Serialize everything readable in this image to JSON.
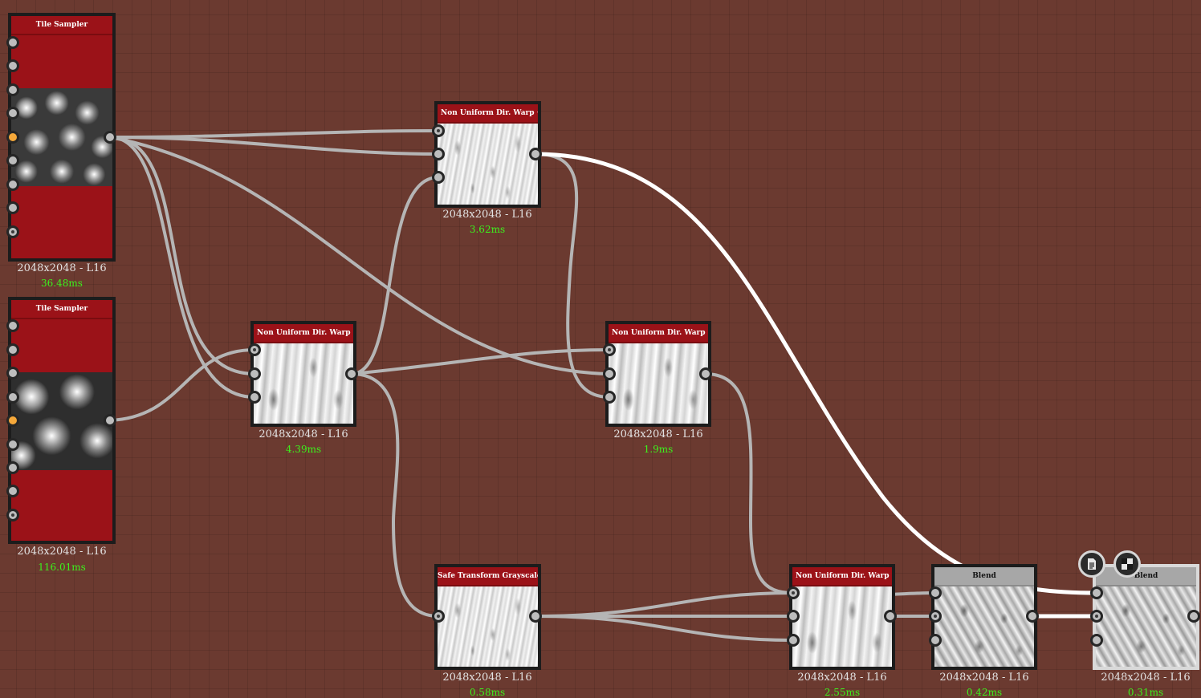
{
  "graph": {
    "nodes": [
      {
        "id": "tile1",
        "title": "Tile Sampler",
        "resolution": "2048x2048 - L16",
        "time": "36.48ms"
      },
      {
        "id": "tile2",
        "title": "Tile Sampler",
        "resolution": "2048x2048 - L16",
        "time": "116.01ms"
      },
      {
        "id": "warpTop",
        "title": "Non Uniform Dir. Warp ···",
        "resolution": "2048x2048 - L16",
        "time": "3.62ms"
      },
      {
        "id": "warpMid",
        "title": "Non Uniform Dir. Warp ···",
        "resolution": "2048x2048 - L16",
        "time": "4.39ms"
      },
      {
        "id": "warpRight",
        "title": "Non Uniform Dir. Warp ···",
        "resolution": "2048x2048 - L16",
        "time": "1.9ms"
      },
      {
        "id": "safe",
        "title": "Safe Transform Grayscale",
        "resolution": "2048x2048 - L16",
        "time": "0.58ms"
      },
      {
        "id": "warpBot",
        "title": "Non Uniform Dir. Warp ···",
        "resolution": "2048x2048 - L16",
        "time": "2.55ms"
      },
      {
        "id": "blend1",
        "title": "Blend",
        "resolution": "2048x2048 - L16",
        "time": "0.42ms"
      },
      {
        "id": "blend2",
        "title": "Blend",
        "resolution": "2048x2048 - L16",
        "time": "0.31ms"
      }
    ]
  },
  "toolbar": {
    "icons": [
      "document-icon",
      "checker-icon"
    ]
  },
  "colors": {
    "canvas": "#6b3a30",
    "node_header": "#9b1218",
    "blend_header": "#a7a7a7",
    "wire": "#b5b5b5",
    "wire_selected": "#ffffff",
    "time_text": "#3cf21c",
    "port_active": "#f5a83a"
  }
}
